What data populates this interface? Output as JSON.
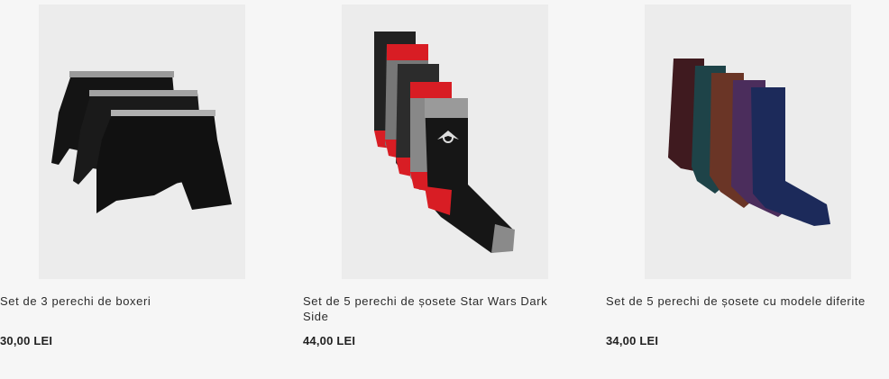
{
  "products": [
    {
      "title": "Set de 3 perechi de boxeri",
      "price": "30,00 LEI",
      "image_icon": "boxer-briefs-image"
    },
    {
      "title": "Set de 5 perechi de șosete Star Wars Dark Side",
      "price": "44,00 LEI",
      "image_icon": "star-wars-socks-image"
    },
    {
      "title": "Set de 5 perechi de șosete cu modele diferite",
      "price": "34,00 LEI",
      "image_icon": "colored-socks-image"
    }
  ]
}
